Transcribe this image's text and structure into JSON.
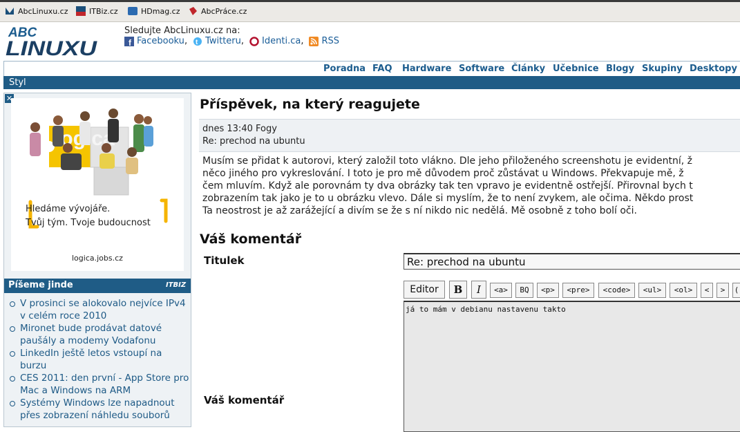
{
  "bookmarks": [
    {
      "label": "AbcLinuxu.cz",
      "icon": "abclinuxu-favicon"
    },
    {
      "label": "ITBiz.cz",
      "icon": "itbiz-favicon"
    },
    {
      "label": "HDmag.cz",
      "icon": "hdmag-favicon"
    },
    {
      "label": "AbcPráce.cz",
      "icon": "abcprace-favicon"
    }
  ],
  "header": {
    "logo_top": "ABC",
    "logo_bottom": "LINUXU",
    "follow_label": "Sledujte AbcLinuxu.cz na:",
    "social": [
      {
        "label": "Facebooku",
        "sep": ",",
        "icon": "facebook-icon"
      },
      {
        "label": "Twitteru",
        "sep": ",",
        "icon": "twitter-icon"
      },
      {
        "label": "Identi.ca",
        "sep": ",",
        "icon": "identica-icon"
      },
      {
        "label": "RSS",
        "sep": "",
        "icon": "rss-icon"
      }
    ]
  },
  "nav": [
    "Poradna",
    "FAQ",
    "Hardware",
    "Software",
    "Články",
    "Učebnice",
    "Blogy",
    "Skupiny",
    "Desktopy"
  ],
  "style_bar": "Styl",
  "ad": {
    "close": "✕",
    "brand": "logica",
    "line1": "Hledáme vývojáře.",
    "line2": "Tvůj tým. Tvoje budoucnost",
    "url": "logica.jobs.cz"
  },
  "sidebar_section": {
    "title": "Píšeme jinde",
    "badge": "ITBIZ",
    "items": [
      "V prosinci se alokovalo nejvíce IPv4 v celém roce 2010",
      "Mironet bude prodávat datové paušály a modemy Vodafonu",
      "LinkedIn ještě letos vstoupí na burzu",
      "CES 2011: den první - App Store pro Mac a Windows na ARM",
      "Systémy Windows lze napadnout přes zobrazení náhledu souborů"
    ]
  },
  "post": {
    "heading": "Příspěvek, na který reagujete",
    "meta": "dnes 13:40 Fogy",
    "subject": "Re: prechod na ubuntu",
    "body_lines": [
      "Musím se přidat k autorovi, který založil toto vlákno. Dle jeho přiloženého screenshotu je evidentní, ž",
      "něco jiného pro vykreslování. I toto je pro mě důvodem proč zůstávat u Windows. Překvapuje mě, ž",
      "čem mluvím. Když ale porovnám ty dva obrázky tak ten vpravo je evidentně ostřejší. Přirovnal bych t",
      "zobrazením tak jako je to u obrázku vlevo. Dále si myslím, že to není zvykem, ale očima. Někdo prost",
      "Ta neostrost je až zarážející a divím se že s ní nikdo nic nedělá. Mě osobně z toho bolí oči."
    ]
  },
  "form": {
    "heading": "Váš komentář",
    "title_label": "Titulek",
    "title_value": "Re: prechod na ubuntu",
    "comment_label": "Váš komentář",
    "comment_value": "já to mám v debianu nastavenu takto",
    "toolbar": {
      "editor": "Editor",
      "bold": "B",
      "italic": "I",
      "tags": [
        "<a>",
        "BQ",
        "<p>",
        "<pre>",
        "<code>",
        "<ul>",
        "<ol>",
        "<",
        ">",
        "("
      ]
    }
  }
}
